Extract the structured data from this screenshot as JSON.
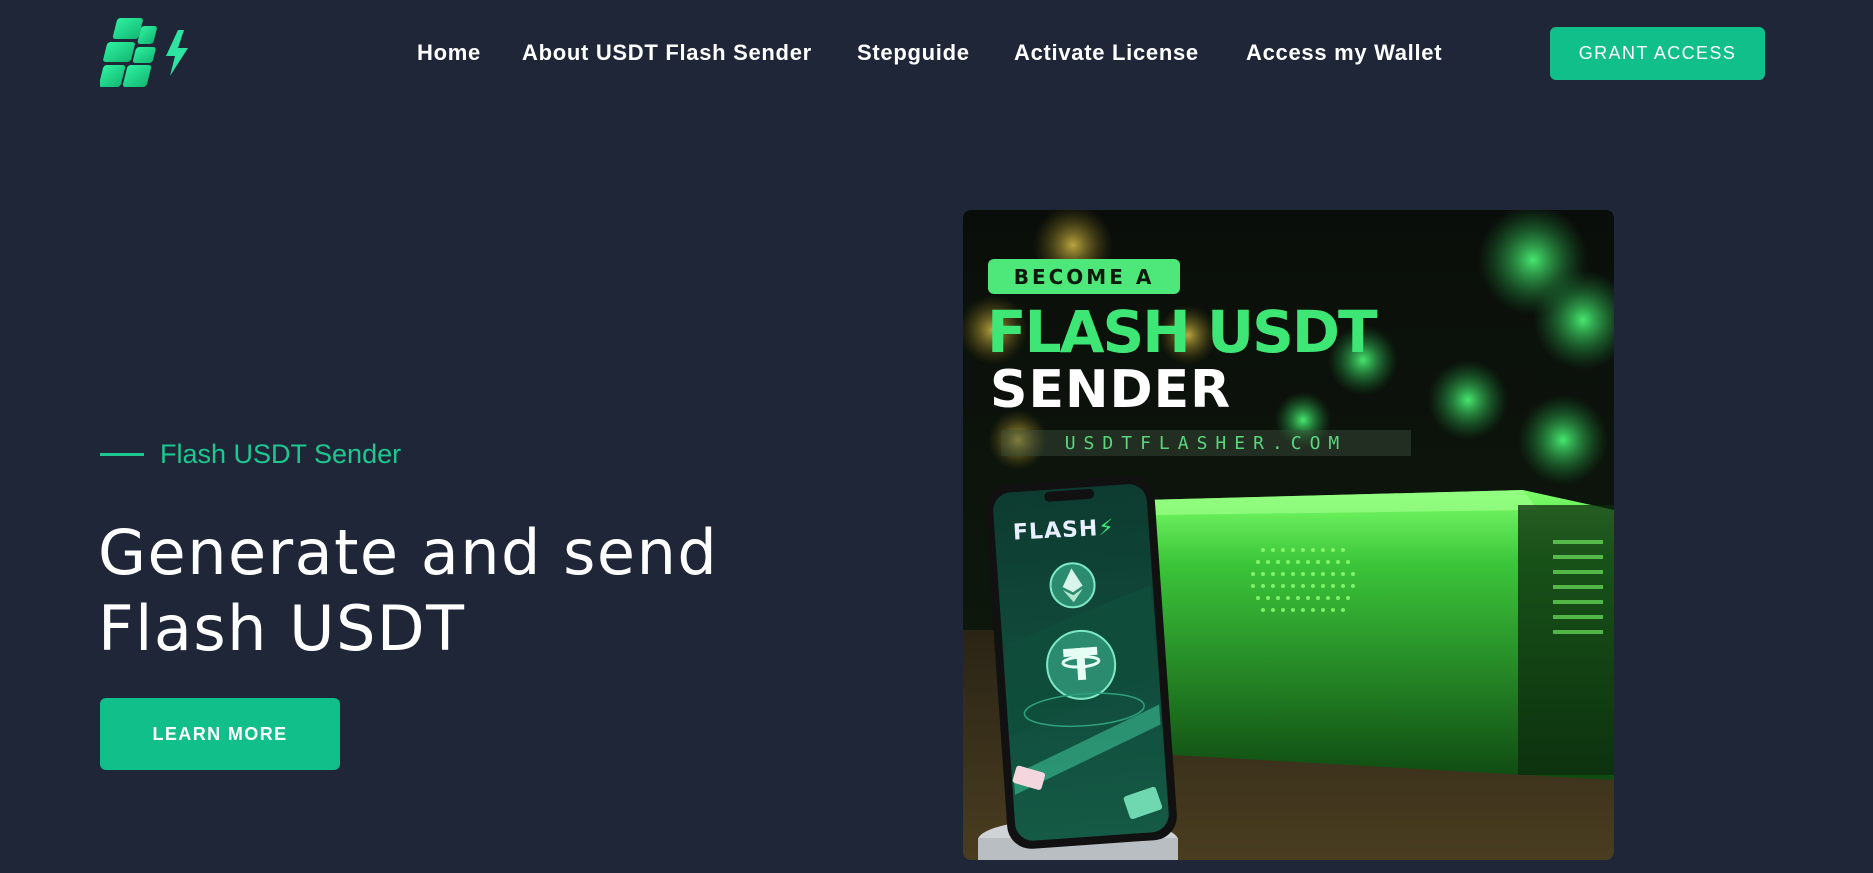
{
  "brand": {
    "logo_icon": "flash-logo-icon",
    "accent_color": "#10bf8a",
    "background_color": "#1e2638"
  },
  "nav": {
    "items": [
      {
        "label": "Home"
      },
      {
        "label": "About USDT Flash Sender"
      },
      {
        "label": "Stepguide"
      },
      {
        "label": "Activate License"
      },
      {
        "label": "Access my Wallet"
      }
    ],
    "cta_label": "GRANT ACCESS"
  },
  "hero": {
    "eyebrow": "Flash USDT Sender",
    "title_line1": "Generate and send",
    "title_line2": "Flash USDT",
    "button_label": "LEARN MORE"
  },
  "promo_image": {
    "badge": "BECOME A",
    "title_line1": "FLASH USDT",
    "title_line2": "SENDER",
    "url": "USDTFLASHER.COM",
    "phone_brand": "FLASH",
    "phone_bolt": "⚡"
  }
}
